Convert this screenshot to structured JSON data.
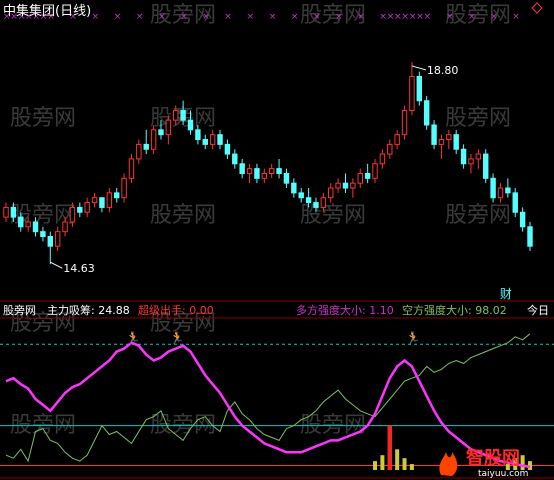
{
  "title": "中集集团(日线)",
  "watermark": "股旁网",
  "brand": {
    "name": "智股网",
    "url": "taiyuu.com"
  },
  "main_panel": {
    "high_label": "18.80",
    "low_label": "14.63",
    "marker_label": "财",
    "ylim": [
      14.2,
      19.5
    ],
    "colors": {
      "up": "#ff3232",
      "down": "#54ffff",
      "marks": "#cc33cc",
      "frame": "#8b0000"
    }
  },
  "indicator_panel": {
    "label_source": "股旁网",
    "label_1": "主力吸筹: 24.88",
    "label_2": "超级出手: 0.00",
    "label_3": "多方强度大小: 1.10",
    "label_4": "空方强度大小: 98.02",
    "label_5": "今日",
    "ylim": [
      0,
      100
    ],
    "ref_lines": [
      85,
      30,
      3
    ],
    "colors": {
      "magenta": "#ff33ff",
      "green": "#80c060",
      "cyan_ref": "#00cccc",
      "red_ref": "#ff3333",
      "label_2": "#ff3333",
      "label_3": "#cc33cc",
      "label_4": "#80c060",
      "label_1": "#ffffff",
      "label_1_value": "#ffff66"
    }
  },
  "chart_data": {
    "type": "candlestick",
    "candles": [
      [
        15.6,
        15.9,
        15.5,
        15.8
      ],
      [
        15.8,
        15.9,
        15.5,
        15.6
      ],
      [
        15.6,
        15.7,
        15.3,
        15.4
      ],
      [
        15.4,
        15.6,
        15.3,
        15.5
      ],
      [
        15.5,
        15.6,
        15.2,
        15.3
      ],
      [
        15.3,
        15.4,
        15.1,
        15.2
      ],
      [
        15.2,
        15.3,
        14.63,
        15.0
      ],
      [
        15.0,
        15.4,
        14.9,
        15.3
      ],
      [
        15.3,
        15.6,
        15.2,
        15.5
      ],
      [
        15.5,
        15.9,
        15.4,
        15.8
      ],
      [
        15.8,
        15.9,
        15.6,
        15.7
      ],
      [
        15.7,
        16.0,
        15.6,
        15.9
      ],
      [
        15.9,
        16.1,
        15.8,
        16.0
      ],
      [
        16.0,
        16.0,
        15.7,
        15.8
      ],
      [
        15.8,
        16.2,
        15.7,
        16.1
      ],
      [
        16.1,
        16.2,
        15.9,
        16.0
      ],
      [
        16.0,
        16.5,
        15.9,
        16.4
      ],
      [
        16.4,
        16.9,
        16.3,
        16.8
      ],
      [
        16.8,
        17.2,
        16.7,
        17.1
      ],
      [
        17.1,
        17.4,
        16.9,
        17.0
      ],
      [
        17.0,
        17.5,
        16.9,
        17.4
      ],
      [
        17.4,
        17.6,
        17.2,
        17.3
      ],
      [
        17.3,
        17.7,
        17.1,
        17.6
      ],
      [
        17.6,
        17.9,
        17.5,
        17.8
      ],
      [
        17.8,
        18.0,
        17.5,
        17.6
      ],
      [
        17.6,
        17.8,
        17.3,
        17.4
      ],
      [
        17.4,
        17.5,
        17.1,
        17.2
      ],
      [
        17.2,
        17.3,
        17.0,
        17.1
      ],
      [
        17.1,
        17.4,
        17.0,
        17.3
      ],
      [
        17.3,
        17.4,
        17.0,
        17.1
      ],
      [
        17.1,
        17.2,
        16.8,
        16.9
      ],
      [
        16.9,
        17.0,
        16.6,
        16.7
      ],
      [
        16.7,
        16.8,
        16.4,
        16.5
      ],
      [
        16.5,
        16.7,
        16.3,
        16.6
      ],
      [
        16.6,
        16.7,
        16.3,
        16.4
      ],
      [
        16.4,
        16.6,
        16.3,
        16.5
      ],
      [
        16.5,
        16.7,
        16.4,
        16.6
      ],
      [
        16.6,
        16.8,
        16.4,
        16.5
      ],
      [
        16.5,
        16.6,
        16.2,
        16.3
      ],
      [
        16.3,
        16.4,
        16.0,
        16.1
      ],
      [
        16.1,
        16.2,
        15.9,
        16.0
      ],
      [
        16.0,
        16.2,
        15.8,
        15.9
      ],
      [
        15.9,
        16.0,
        15.7,
        15.8
      ],
      [
        15.8,
        16.1,
        15.7,
        16.0
      ],
      [
        16.0,
        16.3,
        15.9,
        16.2
      ],
      [
        16.2,
        16.4,
        16.1,
        16.3
      ],
      [
        16.3,
        16.5,
        16.1,
        16.2
      ],
      [
        16.2,
        16.4,
        16.0,
        16.3
      ],
      [
        16.3,
        16.6,
        16.2,
        16.5
      ],
      [
        16.5,
        16.7,
        16.3,
        16.4
      ],
      [
        16.4,
        16.8,
        16.3,
        16.7
      ],
      [
        16.7,
        17.0,
        16.6,
        16.9
      ],
      [
        16.9,
        17.2,
        16.8,
        17.1
      ],
      [
        17.1,
        17.4,
        17.0,
        17.3
      ],
      [
        17.3,
        17.9,
        17.2,
        17.8
      ],
      [
        17.8,
        18.8,
        17.7,
        18.5
      ],
      [
        18.5,
        18.6,
        17.9,
        18.0
      ],
      [
        18.0,
        18.1,
        17.4,
        17.5
      ],
      [
        17.5,
        17.6,
        17.0,
        17.1
      ],
      [
        17.1,
        17.3,
        16.8,
        17.2
      ],
      [
        17.2,
        17.4,
        17.0,
        17.3
      ],
      [
        17.3,
        17.4,
        16.9,
        17.0
      ],
      [
        17.0,
        17.1,
        16.6,
        16.7
      ],
      [
        16.7,
        16.9,
        16.5,
        16.8
      ],
      [
        16.8,
        17.0,
        16.6,
        16.9
      ],
      [
        16.9,
        17.0,
        16.3,
        16.4
      ],
      [
        16.4,
        16.5,
        15.9,
        16.0
      ],
      [
        16.0,
        16.3,
        15.9,
        16.2
      ],
      [
        16.2,
        16.4,
        16.0,
        16.1
      ],
      [
        16.1,
        16.2,
        15.6,
        15.7
      ],
      [
        15.7,
        15.8,
        15.3,
        15.4
      ],
      [
        15.4,
        15.5,
        14.9,
        15.0
      ]
    ],
    "indicator": {
      "main_force": [
        60,
        62,
        58,
        55,
        48,
        44,
        40,
        46,
        52,
        56,
        58,
        62,
        66,
        70,
        74,
        80,
        82,
        86,
        84,
        78,
        74,
        76,
        80,
        82,
        84,
        80,
        72,
        64,
        58,
        52,
        44,
        36,
        30,
        26,
        22,
        18,
        16,
        14,
        12,
        12,
        12,
        14,
        16,
        18,
        20,
        20,
        22,
        24,
        26,
        30,
        38,
        50,
        62,
        70,
        74,
        70,
        60,
        50,
        40,
        32,
        26,
        22,
        18,
        14,
        12,
        10,
        8,
        6,
        5,
        4,
        3,
        2
      ],
      "bull_strength": [
        10,
        8,
        14,
        6,
        26,
        28,
        20,
        18,
        12,
        8,
        6,
        10,
        20,
        30,
        24,
        26,
        22,
        18,
        26,
        34,
        36,
        40,
        28,
        24,
        20,
        28,
        34,
        36,
        30,
        26,
        40,
        46,
        38,
        34,
        28,
        24,
        22,
        20,
        28,
        30,
        34,
        36,
        40,
        46,
        50,
        54,
        48,
        44,
        40,
        38,
        36,
        42,
        48,
        54,
        60,
        62,
        64,
        70,
        66,
        68,
        72,
        74,
        72,
        76,
        78,
        80,
        82,
        84,
        86,
        90,
        88,
        92
      ],
      "bear_strength": [
        90,
        92,
        86,
        94,
        74,
        72,
        80,
        82,
        88,
        92,
        94,
        90,
        80,
        70,
        76,
        74,
        78,
        82,
        74,
        66,
        64,
        60,
        72,
        76,
        80,
        72,
        66,
        64,
        70,
        74,
        60,
        54,
        62,
        66,
        72,
        76,
        78,
        80,
        72,
        70,
        66,
        64,
        60,
        54,
        50,
        46,
        52,
        56,
        60,
        62,
        64,
        58,
        52,
        46,
        40,
        38,
        36,
        30,
        34,
        32,
        28,
        26,
        28,
        24,
        22,
        20,
        18,
        16,
        14,
        10,
        12,
        8
      ],
      "volume_bars": [
        0,
        0,
        0,
        0,
        0,
        0,
        0,
        0,
        0,
        0,
        0,
        0,
        0,
        0,
        0,
        0,
        0,
        0,
        0,
        0,
        0,
        0,
        0,
        0,
        0,
        0,
        0,
        0,
        0,
        0,
        0,
        0,
        0,
        0,
        0,
        0,
        0,
        0,
        0,
        0,
        0,
        0,
        0,
        0,
        0,
        0,
        0,
        0,
        0,
        0,
        6,
        10,
        30,
        14,
        8,
        4,
        0,
        0,
        0,
        0,
        0,
        0,
        0,
        0,
        0,
        0,
        0,
        0,
        4,
        8,
        10,
        6
      ]
    }
  }
}
